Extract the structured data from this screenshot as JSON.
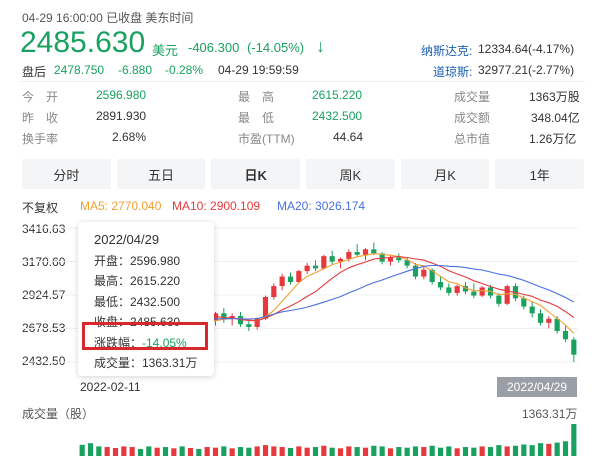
{
  "header": {
    "status_line": "04-29 16:00:00  已收盘  美东时间",
    "price": "2485.630",
    "currency": "美元",
    "change": "-406.300",
    "change_pct": "(-14.05%)",
    "down_arrow": "↓",
    "after_hours_label": "盘后",
    "after_hours_price": "2478.750",
    "after_hours_change": "-6.880",
    "after_hours_pct": "-0.28%",
    "after_hours_time": "04-29 19:59:59",
    "nasdaq_label": "纳斯达克:",
    "nasdaq_value": "12334.64(-4.17%)",
    "dow_label": "道琼斯:",
    "dow_value": "32977.21(-2.77%)"
  },
  "stats": {
    "open_label": "今　开",
    "open": "2596.980",
    "high_label": "最　高",
    "high": "2615.220",
    "volume_label": "成交量",
    "volume": "1363万股",
    "prev_label": "昨　收",
    "prev": "2891.930",
    "low_label": "最　低",
    "low": "2432.500",
    "amount_label": "成交额",
    "amount": "348.04亿",
    "turnover_label": "换手率",
    "turnover": "2.68%",
    "pe_label": "市盈(TTM)",
    "pe": "44.64",
    "mcap_label": "总市值",
    "mcap": "1.26万亿"
  },
  "tabs": [
    "分时",
    "五日",
    "日K",
    "周K",
    "月K",
    "1年"
  ],
  "active_tab": "日K",
  "indicators": {
    "adjust": "不复权",
    "ma5": "MA5: 2770.040",
    "ma10": "MA10: 2900.109",
    "ma20": "MA20: 3026.174",
    "ma5_color": "#f0a030",
    "ma10_color": "#e6393d",
    "ma20_color": "#4a6fe0"
  },
  "chart_data": {
    "type": "candlestick",
    "y_ticks": [
      "3416.63",
      "3170.60",
      "2924.57",
      "2678.53",
      "2432.50"
    ],
    "ylim": [
      2432.5,
      3416.63
    ],
    "x_start_label": "2022-02-11",
    "x_end_label": "2022/04/29",
    "volume_label": "成交量（股）",
    "volume_last": "1363.31万",
    "up_color": "#e6393d",
    "down_color": "#19a15f",
    "candles": [
      [
        2870,
        2890,
        2700,
        2720
      ],
      [
        2720,
        2760,
        2650,
        2680
      ],
      [
        2680,
        2700,
        2580,
        2600
      ],
      [
        2600,
        2660,
        2540,
        2640
      ],
      [
        2640,
        2740,
        2620,
        2720
      ],
      [
        2720,
        2840,
        2700,
        2830
      ],
      [
        2830,
        2900,
        2800,
        2880
      ],
      [
        2880,
        2920,
        2820,
        2850
      ],
      [
        2850,
        2880,
        2760,
        2780
      ],
      [
        2780,
        2860,
        2750,
        2840
      ],
      [
        2840,
        2860,
        2730,
        2750
      ],
      [
        2750,
        2800,
        2700,
        2780
      ],
      [
        2780,
        2800,
        2680,
        2700
      ],
      [
        2700,
        2760,
        2650,
        2740
      ],
      [
        2740,
        2780,
        2690,
        2710
      ],
      [
        2710,
        2760,
        2680,
        2740
      ],
      [
        2740,
        2800,
        2700,
        2790
      ],
      [
        2790,
        2830,
        2720,
        2750
      ],
      [
        2750,
        2790,
        2700,
        2770
      ],
      [
        2770,
        2800,
        2690,
        2710
      ],
      [
        2710,
        2740,
        2660,
        2690
      ],
      [
        2690,
        2760,
        2670,
        2750
      ],
      [
        2750,
        2920,
        2740,
        2910
      ],
      [
        2910,
        3010,
        2890,
        2990
      ],
      [
        2990,
        3080,
        2960,
        3060
      ],
      [
        3060,
        3090,
        3000,
        3020
      ],
      [
        3020,
        3110,
        3010,
        3100
      ],
      [
        3100,
        3160,
        3080,
        3140
      ],
      [
        3140,
        3180,
        3100,
        3120
      ],
      [
        3120,
        3220,
        3110,
        3210
      ],
      [
        3210,
        3250,
        3150,
        3170
      ],
      [
        3170,
        3200,
        3120,
        3190
      ],
      [
        3190,
        3260,
        3170,
        3240
      ],
      [
        3240,
        3300,
        3200,
        3220
      ],
      [
        3220,
        3270,
        3180,
        3260
      ],
      [
        3260,
        3310,
        3220,
        3230
      ],
      [
        3230,
        3240,
        3150,
        3170
      ],
      [
        3170,
        3220,
        3140,
        3200
      ],
      [
        3200,
        3230,
        3160,
        3180
      ],
      [
        3180,
        3200,
        3120,
        3140
      ],
      [
        3140,
        3160,
        3040,
        3060
      ],
      [
        3060,
        3140,
        3040,
        3110
      ],
      [
        3110,
        3120,
        3000,
        3020
      ],
      [
        3020,
        3060,
        2960,
        2980
      ],
      [
        2980,
        3010,
        2920,
        2940
      ],
      [
        2940,
        3000,
        2920,
        2990
      ],
      [
        2990,
        3020,
        2930,
        2950
      ],
      [
        2950,
        3010,
        2900,
        2920
      ],
      [
        2920,
        2990,
        2910,
        2980
      ],
      [
        2980,
        3000,
        2900,
        2920
      ],
      [
        2920,
        2940,
        2840,
        2860
      ],
      [
        2860,
        3000,
        2850,
        2990
      ],
      [
        2990,
        3010,
        2880,
        2900
      ],
      [
        2900,
        2920,
        2820,
        2840
      ],
      [
        2840,
        2880,
        2760,
        2790
      ],
      [
        2790,
        2820,
        2700,
        2720
      ],
      [
        2720,
        2770,
        2680,
        2750
      ],
      [
        2750,
        2770,
        2640,
        2660
      ],
      [
        2660,
        2700,
        2580,
        2600
      ],
      [
        2597,
        2615,
        2432,
        2486
      ]
    ],
    "volumes": [
      0.35,
      0.4,
      0.3,
      0.28,
      0.25,
      0.3,
      0.28,
      0.22,
      0.3,
      0.26,
      0.28,
      0.24,
      0.3,
      0.25,
      0.22,
      0.28,
      0.26,
      0.3,
      0.24,
      0.28,
      0.26,
      0.3,
      0.34,
      0.3,
      0.28,
      0.25,
      0.3,
      0.26,
      0.28,
      0.32,
      0.26,
      0.24,
      0.3,
      0.28,
      0.26,
      0.32,
      0.3,
      0.24,
      0.28,
      0.26,
      0.3,
      0.28,
      0.32,
      0.26,
      0.3,
      0.24,
      0.28,
      0.26,
      0.3,
      0.28,
      0.34,
      0.3,
      0.32,
      0.36,
      0.34,
      0.4,
      0.38,
      0.42,
      0.46,
      1.0
    ]
  },
  "tooltip": {
    "date": "2022/04/29",
    "open": "开盘：2596.980",
    "high": "最高：2615.220",
    "low": "最低：2432.500",
    "close": "收盘：2485.630",
    "change_label": "涨跌幅：",
    "change_value": "-14.05%",
    "volume": "成交量：1363.31万"
  }
}
